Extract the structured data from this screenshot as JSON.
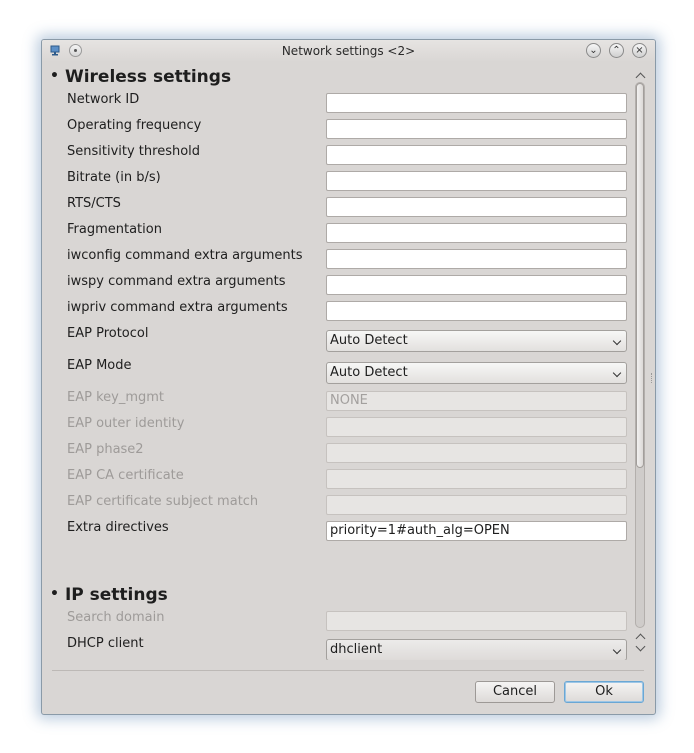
{
  "window": {
    "title": "Network settings <2>"
  },
  "titlebar_icons": [
    "app-icon",
    "menu-icon",
    "minimize-icon",
    "maximize-icon",
    "close-icon"
  ],
  "titlebar_glyphs": {
    "minimize": "⌄",
    "maximize": "⌃",
    "close": "×"
  },
  "sections": {
    "wireless": {
      "bullet": "•",
      "title": "Wireless settings"
    },
    "ip": {
      "bullet": "•",
      "title": "IP settings"
    }
  },
  "wireless": {
    "network_id": {
      "label": "Network ID",
      "value": ""
    },
    "operating_frequency": {
      "label": "Operating frequency",
      "value": ""
    },
    "sensitivity_threshold": {
      "label": "Sensitivity threshold",
      "value": ""
    },
    "bitrate": {
      "label": "Bitrate (in b/s)",
      "value": ""
    },
    "rts_cts": {
      "label": "RTS/CTS",
      "value": ""
    },
    "fragmentation": {
      "label": "Fragmentation",
      "value": ""
    },
    "iwconfig": {
      "label": "iwconfig command extra arguments",
      "value": ""
    },
    "iwspy": {
      "label": "iwspy command extra arguments",
      "value": ""
    },
    "iwpriv": {
      "label": "iwpriv command extra arguments",
      "value": ""
    },
    "eap_protocol": {
      "label": "EAP Protocol",
      "value": "Auto Detect"
    },
    "eap_mode": {
      "label": "EAP Mode",
      "value": "Auto Detect"
    },
    "eap_key_mgmt": {
      "label": "EAP key_mgmt",
      "value": "NONE"
    },
    "eap_outer_identity": {
      "label": "EAP outer identity",
      "value": ""
    },
    "eap_phase2": {
      "label": "EAP phase2",
      "value": ""
    },
    "eap_ca_certificate": {
      "label": "EAP CA certificate",
      "value": ""
    },
    "eap_cert_subject_match": {
      "label": "EAP certificate subject match",
      "value": ""
    },
    "extra_directives": {
      "label": "Extra directives",
      "value": "priority=1#auth_alg=OPEN"
    }
  },
  "ip": {
    "search_domain": {
      "label": "Search domain",
      "value": ""
    },
    "dhcp_client": {
      "label": "DHCP client",
      "value": "dhclient"
    }
  },
  "buttons": {
    "cancel": "Cancel",
    "ok": "Ok"
  },
  "colors": {
    "window_bg": "#d9d6d4",
    "focus_ring": "#6aa7d4",
    "disabled_text": "#9e9b99"
  }
}
